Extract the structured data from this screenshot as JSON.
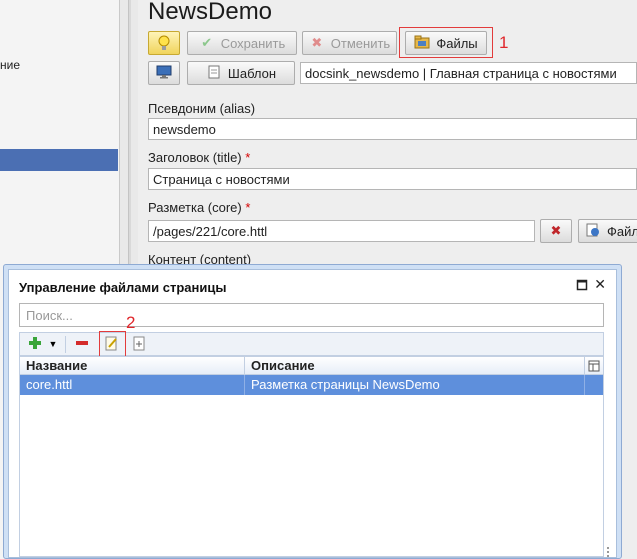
{
  "sidebar": {
    "item_fragment": "ние"
  },
  "page": {
    "title": "NewsDemo"
  },
  "toolbar": {
    "save_label": "Сохранить",
    "cancel_label": "Отменить",
    "files_label": "Файлы",
    "template_label": "Шаблон",
    "template_value": "docsink_newsdemo | Главная страница с новостями"
  },
  "annotations": {
    "one": "1",
    "two": "2"
  },
  "form": {
    "alias_label": "Псевдоним (alias)",
    "alias_value": "newsdemo",
    "title_label": "Заголовок (title)",
    "title_value": "Страница с новостями",
    "markup_label": "Разметка (core)",
    "markup_value": "/pages/221/core.httl",
    "markup_files_label": "Файл",
    "content_label": "Контент (content)",
    "required_mark": "*"
  },
  "dialog": {
    "title": "Управление файлами страницы",
    "search_placeholder": "Поиск...",
    "columns": [
      "Название",
      "Описание"
    ],
    "rows": [
      {
        "name": "core.httl",
        "description": "Разметка страницы NewsDemo"
      }
    ]
  },
  "icons": [
    "lightbulb-icon",
    "checkmark-icon",
    "cross-icon",
    "folder-icon",
    "monitor-icon",
    "document-icon",
    "delete-icon",
    "add-icon",
    "dropdown-arrow-icon",
    "remove-icon",
    "edit-file-icon",
    "add-file-icon",
    "maximize-icon",
    "close-icon",
    "column-menu-icon"
  ],
  "colors": {
    "selection": "#5e8fdc",
    "annotation": "#e23b3b"
  }
}
